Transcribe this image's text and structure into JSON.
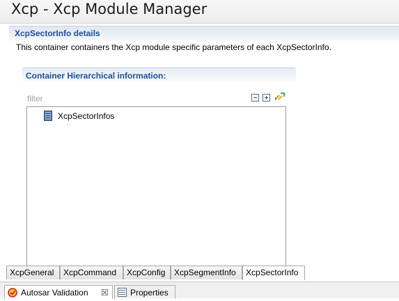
{
  "header": {
    "title": "Xcp - Xcp Module Manager"
  },
  "section": {
    "title": "XcpSectorInfo details",
    "description": "This container containers the Xcp module specific parameters of each XcpSectorInfo."
  },
  "group": {
    "title": "Container Hierarchical information:",
    "filter_placeholder": "filter",
    "toolbar": {
      "collapse_icon": "collapse-all-icon",
      "expand_icon": "expand-all-icon",
      "sync_icon": "link-with-editor-icon"
    },
    "tree": [
      {
        "label": "XcpSectorInfos",
        "icon": "container-document-icon"
      }
    ]
  },
  "tabs": [
    {
      "label": "XcpGeneral",
      "active": false
    },
    {
      "label": "XcpCommand",
      "active": false
    },
    {
      "label": "XcpConfig",
      "active": false
    },
    {
      "label": "XcpSegmentInfo",
      "active": false
    },
    {
      "label": "XcpSectorInfo",
      "active": true
    }
  ],
  "bottom_tabs": [
    {
      "label": "Autosar Validation",
      "icon": "validation-icon",
      "close": "☒",
      "active": true
    },
    {
      "label": "Properties",
      "icon": "properties-icon",
      "active": false
    }
  ],
  "colors": {
    "section_title": "#1c4f9c",
    "header_bg": "#ececec"
  }
}
